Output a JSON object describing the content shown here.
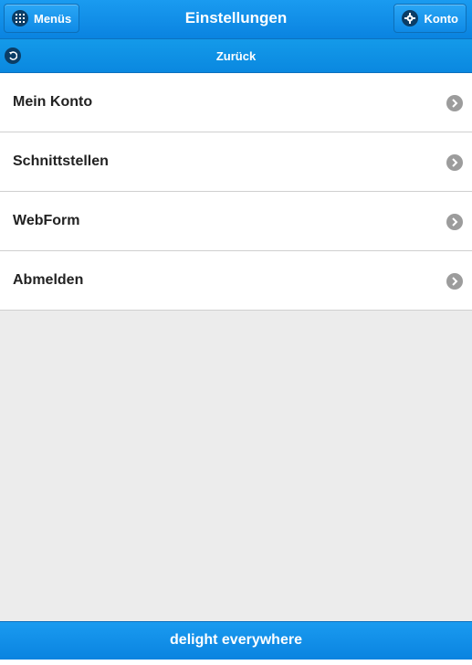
{
  "header": {
    "title": "Einstellungen",
    "left_button": {
      "label": "Menüs",
      "icon": "grid-icon"
    },
    "right_button": {
      "label": "Konto",
      "icon": "gear-icon"
    }
  },
  "subbar": {
    "back_label": "Zurück",
    "icon": "back-arrow-icon"
  },
  "menu": {
    "items": [
      {
        "label": "Mein Konto"
      },
      {
        "label": "Schnittstellen"
      },
      {
        "label": "WebForm"
      },
      {
        "label": "Abmelden"
      }
    ]
  },
  "footer": {
    "label": "delight everywhere"
  },
  "colors": {
    "accent": "#0a88e0",
    "background": "#ececec",
    "chevron": "#9c9c9c"
  }
}
